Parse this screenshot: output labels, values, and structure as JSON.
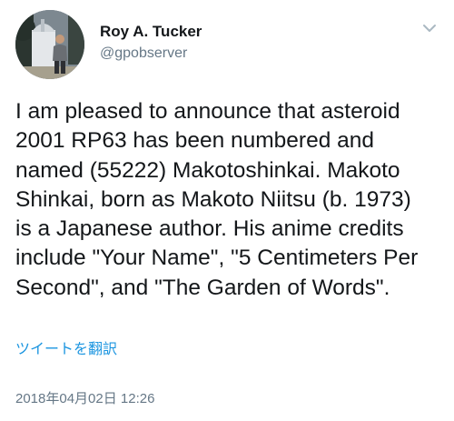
{
  "tweet": {
    "author": {
      "display_name": "Roy A. Tucker",
      "handle": "@gpobserver"
    },
    "text_lines": [
      "I am pleased to announce that asteroid",
      "2001 RP63 has been numbered and",
      "named (55222) Makotoshinkai. Makoto",
      "Shinkai, born as Makoto Niitsu (b. 1973)",
      "is a Japanese author. His anime credits",
      "include \"Your Name\", \"5 Centimeters Per",
      "Second\", and \"The Garden of Words\"."
    ],
    "translate_label": "ツイートを翻訳",
    "timestamp": "2018年04月02日 12:26",
    "menu_icon": "chevron-down-icon"
  },
  "colors": {
    "text": "#14171a",
    "secondary": "#657786",
    "link": "#1b95e0",
    "chevron": "#aab8c2"
  }
}
